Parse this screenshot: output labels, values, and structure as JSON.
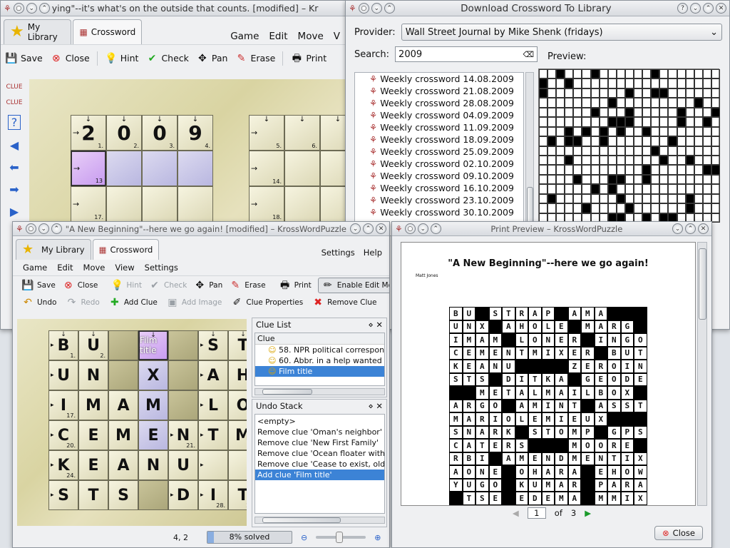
{
  "win_main": {
    "title": "ying\"--it's what's on the outside that counts. [modified] – Kr",
    "tabs": [
      "My Library",
      "Crossword"
    ],
    "menu": [
      "Game",
      "Edit",
      "Move",
      "V"
    ],
    "toolbar": [
      "Save",
      "Close",
      "Hint",
      "Check",
      "Pan",
      "Erase",
      "Print"
    ],
    "grid_letters": [
      "2",
      "0",
      "0",
      "9"
    ],
    "grid_numbers": [
      "1.",
      "2.",
      "3.",
      "4.",
      "5.",
      "6.",
      "13",
      "14.",
      "17.",
      "18."
    ]
  },
  "win_download": {
    "title": "Download Crossword To Library",
    "provider_label": "Provider:",
    "provider_value": "Wall Street Journal by Mike Shenk (fridays)",
    "search_label": "Search:",
    "search_value": "2009",
    "preview_label": "Preview:",
    "items": [
      "Weekly crossword 14.08.2009",
      "Weekly crossword 21.08.2009",
      "Weekly crossword 28.08.2009",
      "Weekly crossword 04.09.2009",
      "Weekly crossword 11.09.2009",
      "Weekly crossword 18.09.2009",
      "Weekly crossword 25.09.2009",
      "Weekly crossword 02.10.2009",
      "Weekly crossword 09.10.2009",
      "Weekly crossword 16.10.2009",
      "Weekly crossword 23.10.2009",
      "Weekly crossword 30.10.2009"
    ]
  },
  "win_new": {
    "title": "\"A New Beginning\"--here we go again! [modified] – KrossWordPuzzle",
    "tabs": [
      "My Library",
      "Crossword"
    ],
    "menu_right": [
      "Settings",
      "Help"
    ],
    "menu": [
      "Game",
      "Edit",
      "Move",
      "View",
      "Settings"
    ],
    "toolbar1": [
      "Save",
      "Close",
      "Hint",
      "Check",
      "Pan",
      "Erase",
      "Print",
      "Enable Edit Mode"
    ],
    "toolbar2": [
      "Undo",
      "Redo",
      "Add Clue",
      "Add Image",
      "Clue Properties",
      "Remove Clue"
    ],
    "clue_list_title": "Clue List",
    "clue_header": "Clue",
    "clues": [
      "58. NPR political correspon",
      "60. Abbr. in a help wanted a",
      "Film title"
    ],
    "undo_title": "Undo Stack",
    "undo_items": [
      "<empty>",
      "Remove clue 'Oman's neighbor'",
      "Remove clue 'New First Family'",
      "Remove clue 'Ocean floater with a...",
      "Remove clue 'Cease to exist, old-...",
      "Add clue 'Film title'"
    ],
    "status_pos": "4, 2",
    "progress_text": "8% solved",
    "progress_value": 0.08,
    "film_title": "Film title",
    "grid_letters": [
      [
        "B",
        "U",
        "",
        "",
        "",
        "S",
        "T"
      ],
      [
        "U",
        "N",
        "",
        "X",
        "",
        "A",
        "H"
      ],
      [
        "I",
        "M",
        "A",
        "M",
        "",
        "L",
        "O"
      ],
      [
        "C",
        "E",
        "M",
        "E",
        "N",
        "T",
        "M"
      ],
      [
        "K",
        "E",
        "A",
        "N",
        "U",
        "",
        ""
      ],
      [
        "S",
        "T",
        "S",
        "",
        "D",
        "I",
        "T"
      ]
    ],
    "grid_numbers": [
      "1.",
      "2.",
      "17.",
      "20.",
      "21.",
      "24.",
      "28.",
      "29."
    ]
  },
  "win_print": {
    "title": "Print Preview – KrossWordPuzzle",
    "puzzle_title": "\"A New Beginning\"--here we go again!",
    "author": "Matt Jones",
    "page_current": "1",
    "page_of": "of",
    "page_total": "3",
    "close_label": "Close",
    "rows": [
      "BU.STRAP.AMA.",
      "UNX.AHOLE.MARG",
      "IMAM.LONER.INGO",
      "CEMENTMIXER.BUT",
      "KEANU....ZEROIN",
      "STS.DITKA.GEODE",
      "..METALMAILBOX.",
      "ARGO.AMINT.ASST",
      "MARIOLEMIEUX...",
      "SNARK.STOMP.GPS",
      "CATERS...MOORE",
      "RBI.AMENDMENTIX",
      "AONE.OHARA.EHOW",
      "YUGO.KUMAR.PARA",
      ".TSE.EDEMA.MMIX"
    ]
  },
  "colors": {
    "selection": "#3c83d6",
    "progress": "#8aaee0",
    "board_bg": "#ddd8a8"
  }
}
